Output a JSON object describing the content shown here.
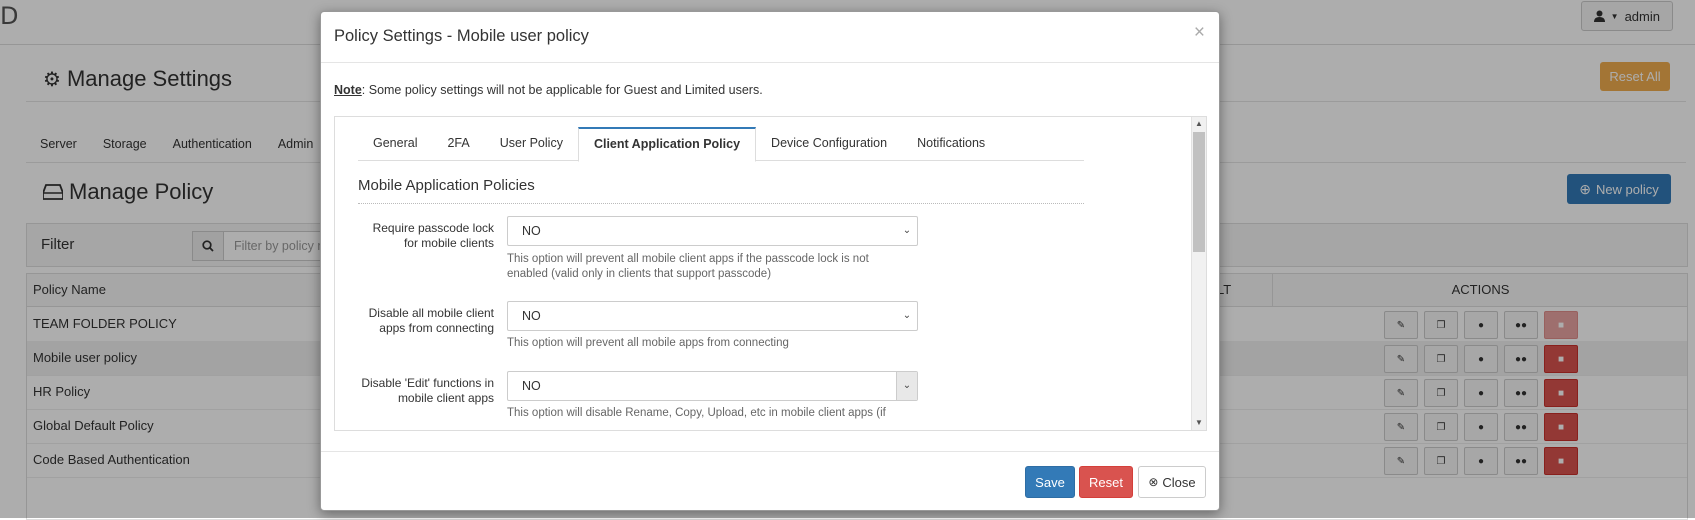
{
  "app": {
    "logo_fragment": "D",
    "admin_label": "admin",
    "manage_settings_title": "Manage Settings",
    "reset_all_label": "Reset All",
    "settings_tabs": [
      "Server",
      "Storage",
      "Authentication",
      "Admin"
    ],
    "manage_policy_title": "Manage Policy",
    "new_policy_label": "New policy",
    "filter_label": "Filter",
    "filter_placeholder": "Filter by policy n",
    "table": {
      "col_name": "Policy Name",
      "col_partial": "LT",
      "col_actions": "ACTIONS",
      "rows": [
        {
          "name": "TEAM FOLDER POLICY"
        },
        {
          "name": "Mobile user policy"
        },
        {
          "name": "HR Policy"
        },
        {
          "name": "Global Default Policy"
        },
        {
          "name": "Code Based Authentication"
        }
      ]
    }
  },
  "modal": {
    "title": "Policy Settings - Mobile user policy",
    "close_glyph": "×",
    "note_label": "Note",
    "note_text": ": Some policy settings will not be applicable for Guest and Limited users.",
    "tabs": [
      "General",
      "2FA",
      "User Policy",
      "Client Application Policy",
      "Device Configuration",
      "Notifications"
    ],
    "active_tab": "Client Application Policy",
    "section_title": "Mobile Application Policies",
    "settings": [
      {
        "label": "Require passcode lock for mobile clients",
        "value": "NO",
        "help": "This option will prevent all mobile client apps if the passcode lock is not enabled (valid only in clients that support passcode)"
      },
      {
        "label": "Disable all mobile client apps from connecting",
        "value": "NO",
        "help": "This option will prevent all mobile apps from connecting"
      },
      {
        "label": "Disable 'Edit' functions in mobile client apps",
        "value": "NO",
        "help": "This option will disable Rename, Copy, Upload, etc in mobile client apps (if"
      }
    ],
    "buttons": {
      "save": "Save",
      "reset": "Reset",
      "close": "Close"
    }
  },
  "colors": {
    "primary": "#337ab7",
    "danger": "#d9534f",
    "warning": "#f0ad4e"
  }
}
